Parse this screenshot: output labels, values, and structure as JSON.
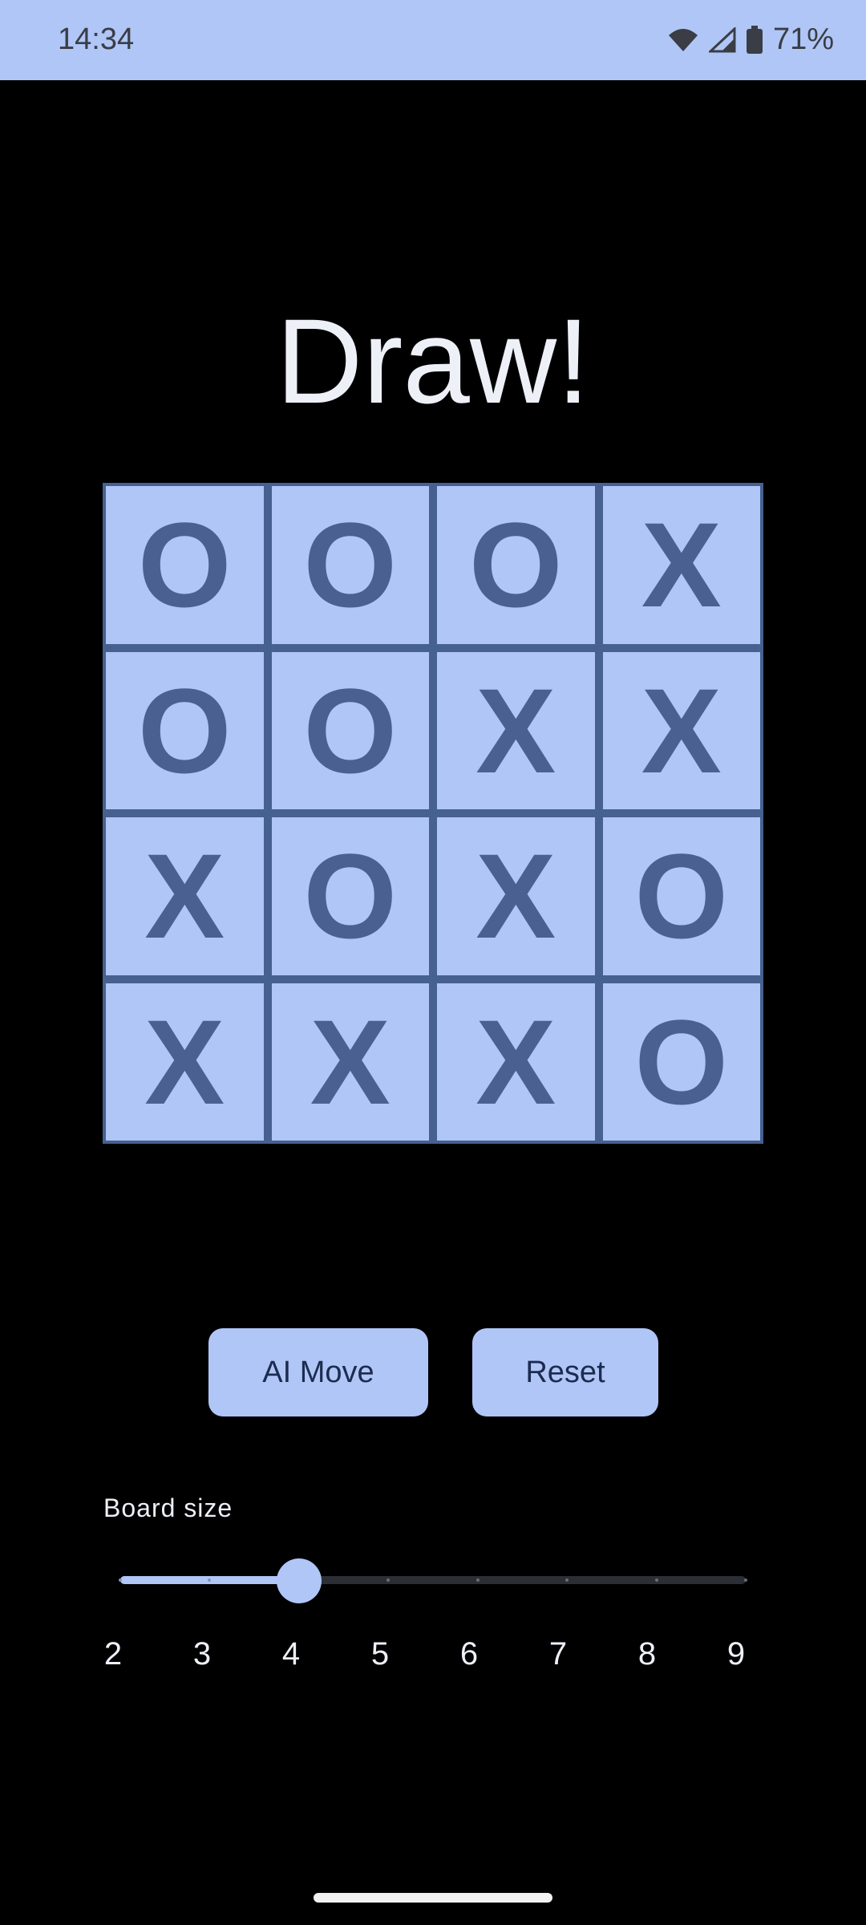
{
  "status_bar": {
    "time": "14:34",
    "battery": "71%",
    "icons": [
      "wifi-icon",
      "cell-signal-icon",
      "battery-icon"
    ]
  },
  "game": {
    "result_title": "Draw!",
    "board_size": 4,
    "board": [
      [
        "O",
        "O",
        "O",
        "X"
      ],
      [
        "O",
        "O",
        "X",
        "X"
      ],
      [
        "X",
        "O",
        "X",
        "O"
      ],
      [
        "X",
        "X",
        "X",
        "O"
      ]
    ]
  },
  "buttons": {
    "ai_move": "AI Move",
    "reset": "Reset"
  },
  "board_size_slider": {
    "label": "Board size",
    "min": 2,
    "max": 9,
    "value": 4,
    "tick_labels": [
      "2",
      "3",
      "4",
      "5",
      "6",
      "7",
      "8",
      "9"
    ]
  },
  "colors": {
    "accent": "#b0c6f7",
    "board_line": "#46608f",
    "mark": "#4a6090",
    "background": "#000000"
  }
}
